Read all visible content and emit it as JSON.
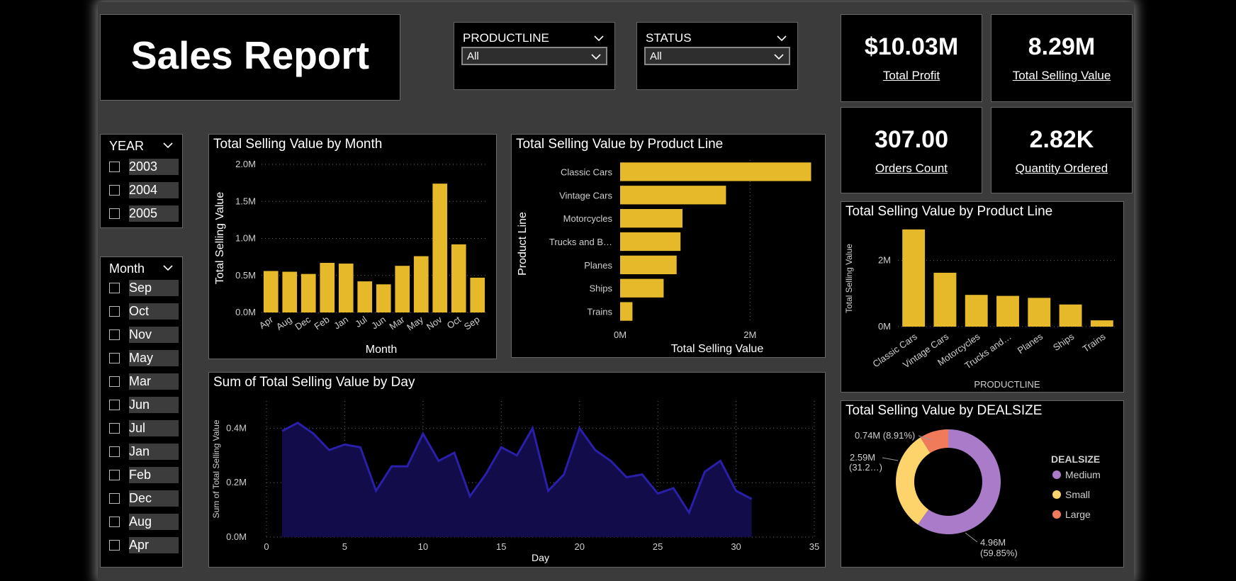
{
  "report_title": "Sales Report",
  "filters": [
    {
      "label": "PRODUCTLINE",
      "value": "All"
    },
    {
      "label": "STATUS",
      "value": "All"
    }
  ],
  "kpis": [
    {
      "value": "$10.03M",
      "caption": "Total Profit"
    },
    {
      "value": "8.29M",
      "caption": "Total Selling Value"
    },
    {
      "value": "307.00",
      "caption": "Orders Count"
    },
    {
      "value": "2.82K",
      "caption": "Quantity Ordered"
    }
  ],
  "year_slicer": {
    "title": "YEAR",
    "items": [
      "2003",
      "2004",
      "2005"
    ]
  },
  "month_slicer": {
    "title": "Month",
    "items": [
      "Sep",
      "Oct",
      "Nov",
      "May",
      "Mar",
      "Jun",
      "Jul",
      "Jan",
      "Feb",
      "Dec",
      "Aug",
      "Apr"
    ]
  },
  "colors": {
    "bar": "#e6b92b",
    "area_fill": "#120c4a",
    "area_line": "#2a1fa8",
    "medium": "#a97bc9",
    "small": "#fdd46c",
    "large": "#f07b5b"
  },
  "chart_data": [
    {
      "type": "bar",
      "title": "Total Selling Value by Month",
      "xlabel": "Month",
      "ylabel": "Total Selling Value",
      "categories": [
        "Apr",
        "Aug",
        "Dec",
        "Feb",
        "Jan",
        "Jul",
        "Jun",
        "Mar",
        "May",
        "Nov",
        "Oct",
        "Sep"
      ],
      "values": [
        0.56,
        0.55,
        0.52,
        0.67,
        0.66,
        0.42,
        0.38,
        0.63,
        0.76,
        1.74,
        0.92,
        0.47
      ],
      "ylim": [
        0,
        2
      ],
      "yticks": [
        "0.0M",
        "0.5M",
        "1.0M",
        "1.5M",
        "2.0M"
      ]
    },
    {
      "type": "bar",
      "orientation": "horizontal",
      "title": "Total Selling Value by Product Line",
      "xlabel": "Total Selling Value",
      "ylabel": "Product Line",
      "categories": [
        "Classic Cars",
        "Vintage Cars",
        "Motorcycles",
        "Trucks and B…",
        "Planes",
        "Ships",
        "Trains"
      ],
      "values": [
        2.94,
        1.63,
        0.96,
        0.93,
        0.87,
        0.67,
        0.19
      ],
      "xlim": [
        0,
        3
      ],
      "xticks": [
        "0M",
        "2M"
      ]
    },
    {
      "type": "bar",
      "title": "Total Selling Value by Product Line",
      "xlabel": "PRODUCTLINE",
      "ylabel": "Total Selling Value",
      "categories": [
        "Classic Cars",
        "Vintage Cars",
        "Motorcycles",
        "Trucks and…",
        "Planes",
        "Ships",
        "Trains"
      ],
      "values": [
        2.94,
        1.63,
        0.96,
        0.93,
        0.87,
        0.67,
        0.19
      ],
      "ylim": [
        0,
        3
      ],
      "yticks": [
        "0M",
        "2M"
      ]
    },
    {
      "type": "area",
      "title": "Sum of Total Selling Value by Day",
      "xlabel": "Day",
      "ylabel": "Sum of Total Selling Value",
      "x": [
        1,
        2,
        3,
        4,
        5,
        6,
        7,
        8,
        9,
        10,
        11,
        12,
        13,
        14,
        15,
        16,
        17,
        18,
        19,
        20,
        21,
        22,
        23,
        24,
        25,
        26,
        27,
        28,
        29,
        30,
        31
      ],
      "y": [
        0.39,
        0.42,
        0.38,
        0.32,
        0.34,
        0.33,
        0.17,
        0.26,
        0.26,
        0.38,
        0.28,
        0.31,
        0.15,
        0.23,
        0.33,
        0.3,
        0.4,
        0.17,
        0.23,
        0.4,
        0.32,
        0.28,
        0.22,
        0.23,
        0.16,
        0.18,
        0.09,
        0.24,
        0.28,
        0.17,
        0.14
      ],
      "xlim": [
        0,
        35
      ],
      "ylim": [
        0,
        0.5
      ],
      "xticks": [
        "0",
        "5",
        "10",
        "15",
        "20",
        "25",
        "30",
        "35"
      ],
      "yticks": [
        "0.0M",
        "0.2M",
        "0.4M"
      ]
    },
    {
      "type": "pie",
      "donut": true,
      "title": "Total Selling Value by DEALSIZE",
      "legend_title": "DEALSIZE",
      "slices": [
        {
          "name": "Medium",
          "value": 59.85,
          "label1": "4.96M",
          "label2": "(59.85%)"
        },
        {
          "name": "Small",
          "value": 31.24,
          "label1": "2.59M",
          "label2": "(31.2…)"
        },
        {
          "name": "Large",
          "value": 8.91,
          "label1": "0.74M (8.91%)",
          "label2": ""
        }
      ]
    }
  ]
}
